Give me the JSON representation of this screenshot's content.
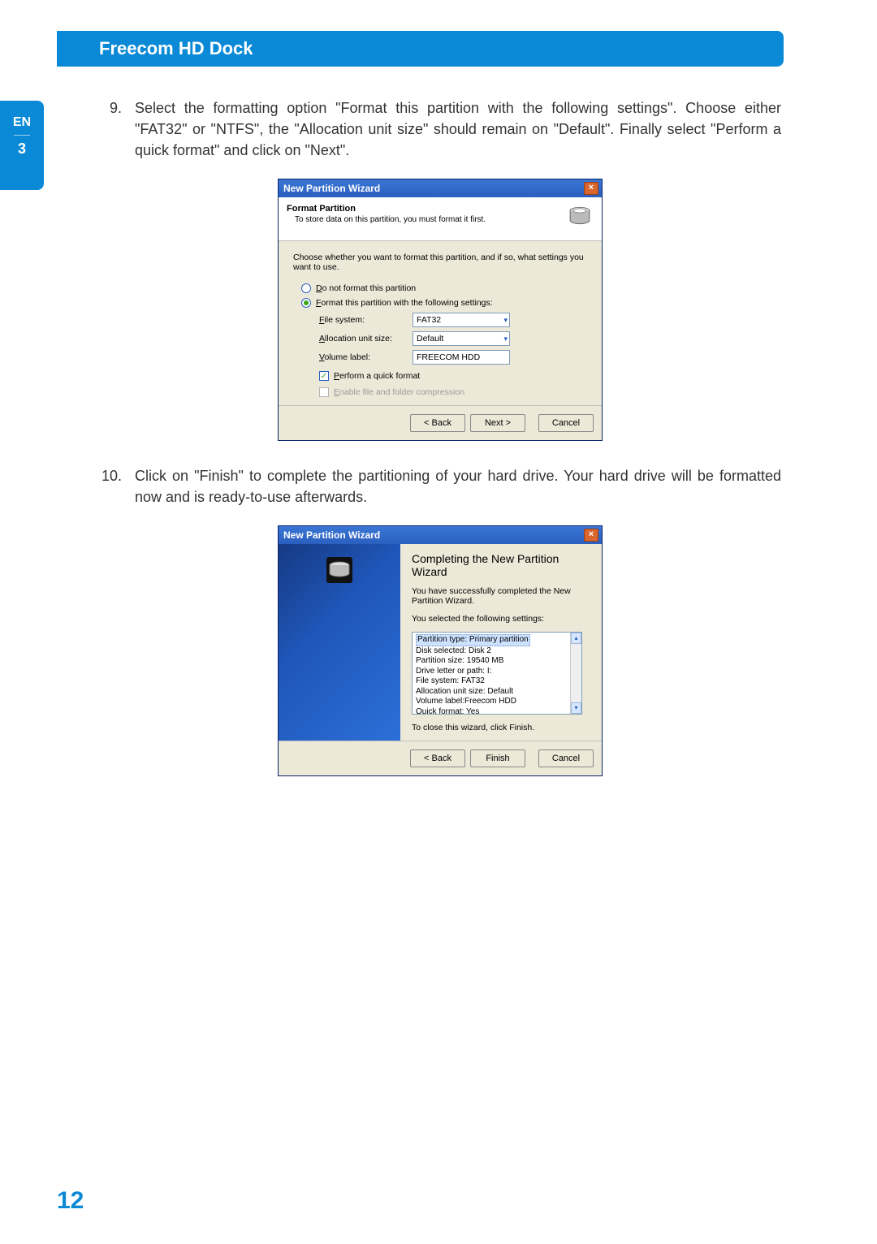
{
  "header": {
    "title": "Freecom HD Dock"
  },
  "side": {
    "lang": "EN",
    "chapter": "3"
  },
  "page_number": "12",
  "steps": {
    "s9": {
      "num": "9.",
      "text": "Select the formatting option \"Format this partition with the following settings\". Choose either \"FAT32\" or \"NTFS\", the \"Allocation unit size\" should remain on \"Default\". Finally select \"Perform a quick format\" and click on \"Next\"."
    },
    "s10": {
      "num": "10.",
      "text": "Click on \"Finish\" to complete the partitioning of your hard drive. Your hard drive will be formatted now and is ready-to-use afterwards."
    }
  },
  "dialog1": {
    "title": "New Partition Wizard",
    "header_title": "Format Partition",
    "header_sub": "To store data on this partition, you must format it first.",
    "instruction": "Choose whether you want to format this partition, and if so, what settings you want to use.",
    "radio_noformat": "Do not format this partition",
    "radio_format": "Format this partition with the following settings:",
    "lbl_fs": "File system:",
    "val_fs": "FAT32",
    "lbl_au": "Allocation unit size:",
    "val_au": "Default",
    "lbl_vl": "Volume label:",
    "val_vl": "FREECOM HDD",
    "chk_quick": "Perform a quick format",
    "chk_compress": "Enable file and folder compression",
    "btn_back": "< Back",
    "btn_next": "Next >",
    "btn_cancel": "Cancel"
  },
  "dialog2": {
    "title": "New Partition Wizard",
    "wiz_title": "Completing the New Partition Wizard",
    "msg_success": "You have successfully completed the New Partition Wizard.",
    "msg_selected": "You selected the following settings:",
    "summary": {
      "l1": "Partition type: Primary partition",
      "l2": "Disk selected: Disk 2",
      "l3": "Partition size: 19540 MB",
      "l4": "Drive letter or path: I:",
      "l5": "File system: FAT32",
      "l6": "Allocation unit size: Default",
      "l7": "Volume label:Freecom HDD",
      "l8": "Quick format: Yes"
    },
    "close_msg": "To close this wizard, click Finish.",
    "btn_back": "< Back",
    "btn_finish": "Finish",
    "btn_cancel": "Cancel"
  }
}
